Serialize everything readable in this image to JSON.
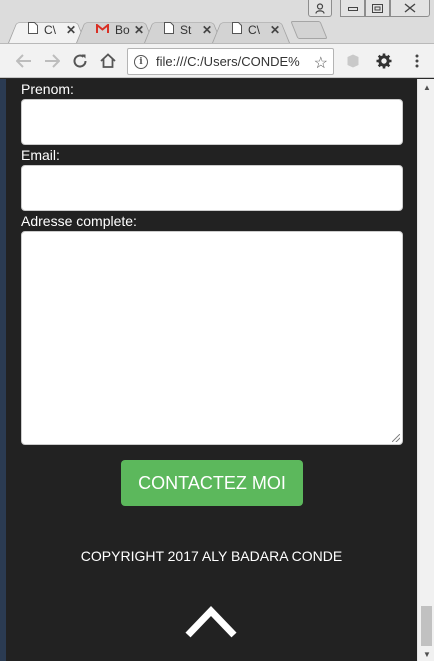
{
  "browser": {
    "tabs": [
      {
        "icon": "page-icon",
        "title": "C\\",
        "active": true
      },
      {
        "icon": "gmail-icon",
        "title": "Bo",
        "active": false
      },
      {
        "icon": "page-icon",
        "title": "St",
        "active": false
      },
      {
        "icon": "page-icon",
        "title": "C\\",
        "active": false
      }
    ],
    "url": "file:///C:/Users/CONDE%",
    "accent_gmail": "#d93025"
  },
  "form": {
    "prenom_label": "Prenom:",
    "prenom_value": "",
    "email_label": "Email:",
    "email_value": "",
    "adresse_label": "Adresse complete:",
    "adresse_value": "",
    "submit_label": "CONTACTEZ MOI",
    "submit_color": "#5cb85c"
  },
  "footer": {
    "copyright": "COPYRIGHT 2017 ALY BADARA CONDE",
    "back_to_top_icon": "chevron-up-icon"
  }
}
